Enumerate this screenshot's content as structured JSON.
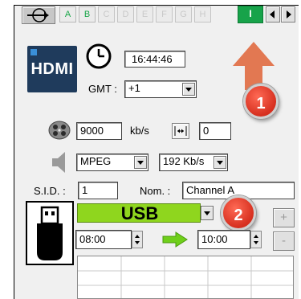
{
  "tabs": {
    "items": [
      {
        "label": "A"
      },
      {
        "label": "B"
      },
      {
        "label": "C"
      },
      {
        "label": "D"
      },
      {
        "label": "E"
      },
      {
        "label": "F"
      },
      {
        "label": "G"
      },
      {
        "label": "H"
      },
      {
        "label": "I",
        "active": true
      }
    ]
  },
  "hdmi": {
    "logo_text": "HDMI"
  },
  "clock": {
    "time": "16:44:46",
    "gmt_label": "GMT :",
    "gmt_value": "+1"
  },
  "stream": {
    "bitrate_value": "9000",
    "bitrate_unit": "kb/s",
    "offset_value": "0"
  },
  "audio": {
    "codec": "MPEG",
    "rate": "192 Kb/s"
  },
  "service": {
    "sid_label": "S.I.D. :",
    "sid_value": "1",
    "name_label": "Nom. :",
    "name_value": "Channel A"
  },
  "record": {
    "source": "USB",
    "start_time": "08:00",
    "end_time": "10:00",
    "plus_label": "+",
    "minus_label": "-"
  },
  "callouts": {
    "one": "1",
    "two": "2"
  },
  "colors": {
    "accent_green": "#17a34a",
    "usb_green": "#8fd61e",
    "callout_red": "#d62f1f",
    "hdmi_blue": "#1f3b5c"
  }
}
